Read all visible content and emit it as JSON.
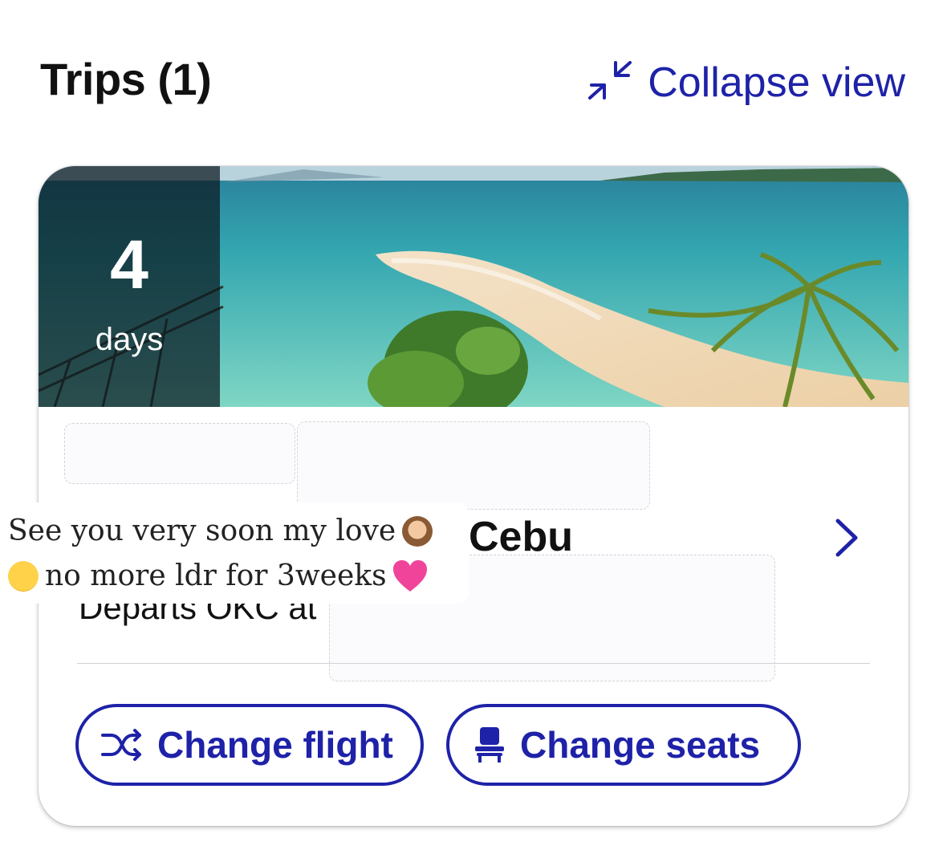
{
  "header": {
    "title": "Trips (1)",
    "collapse_label": "Collapse view"
  },
  "trip": {
    "countdown_number": "4",
    "countdown_unit": "days",
    "destination": "Cebu",
    "departs_label": "Departs OKC at"
  },
  "actions": {
    "change_flight": "Change flight",
    "change_seats": "Change seats"
  },
  "overlay": {
    "line1": "See you very soon my love",
    "line2": "no more ldr for 3weeks"
  },
  "colors": {
    "accent": "#1e22a8",
    "heart": "#f0449a"
  },
  "icons": {
    "collapse": "collapse-arrows-icon",
    "next": "chevron-right-icon",
    "change_flight": "shuffle-icon",
    "change_seats": "seat-icon"
  }
}
